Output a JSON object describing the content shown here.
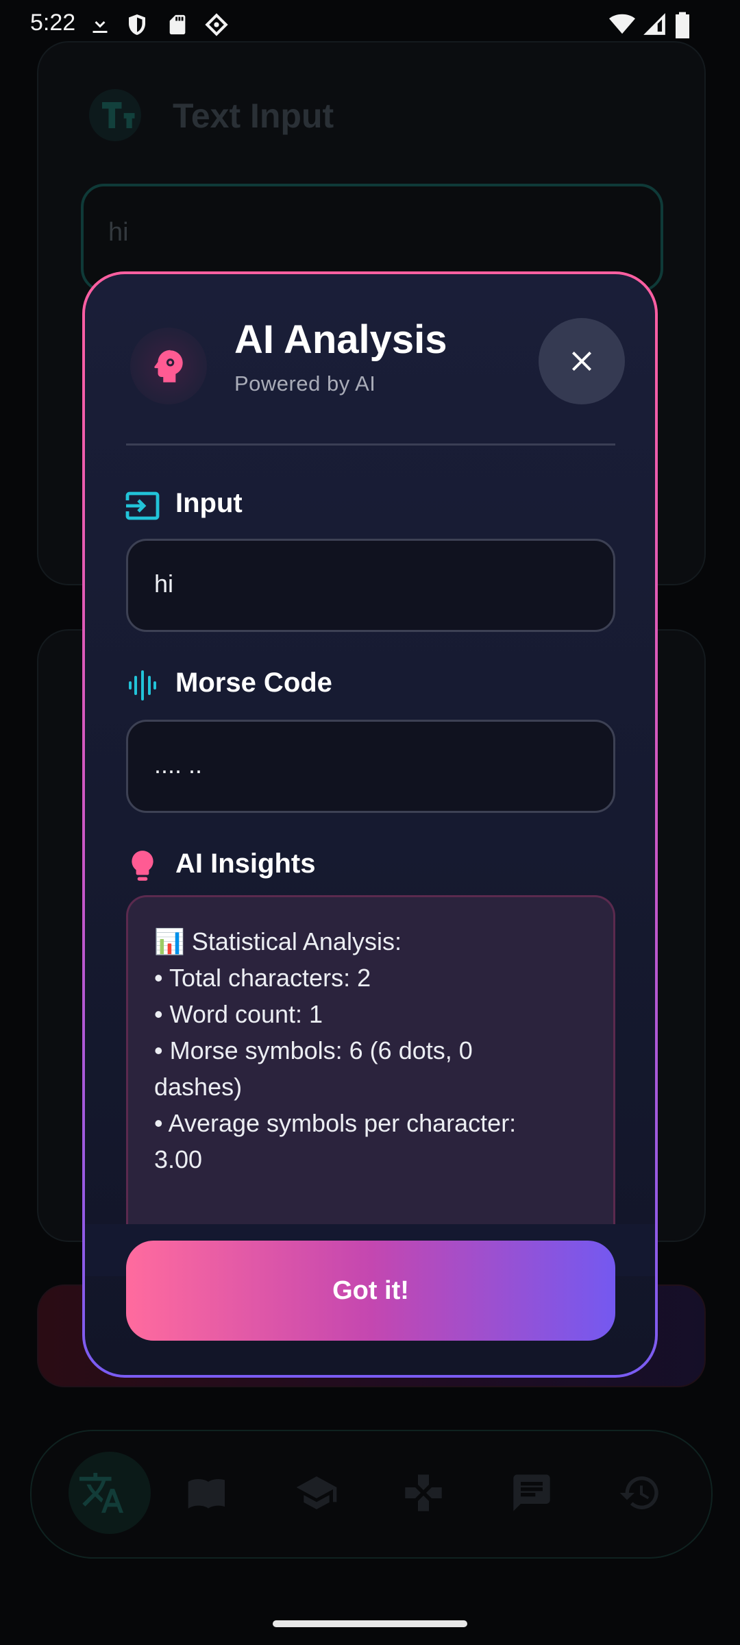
{
  "status_bar": {
    "time": "5:22",
    "left_icons": [
      "download-icon",
      "shield-icon",
      "sd-card-icon",
      "vpn-icon"
    ],
    "right_icons": [
      "wifi-icon",
      "signal-icon",
      "battery-icon"
    ]
  },
  "background": {
    "section_title": "Text Input",
    "input_value": "hi",
    "nav_icons": [
      "translate-icon",
      "book-icon",
      "school-icon",
      "gamepad-icon",
      "chat-icon",
      "history-icon"
    ]
  },
  "dialog": {
    "title": "AI Analysis",
    "subtitle": "Powered by AI",
    "input_label": "Input",
    "input_value": "hi",
    "morse_label": "Morse Code",
    "morse_value": ".... ..",
    "insights_label": "AI Insights",
    "insights_lines": [
      "📊 Statistical Analysis:",
      "• Total characters: 2",
      "• Word count: 1",
      "• Morse symbols: 6 (6 dots, 0",
      "dashes)",
      "• Average symbols per character:",
      "3.00"
    ],
    "confirm_label": "Got it!"
  },
  "colors": {
    "accent_pink": "#ff5fa0",
    "accent_purple": "#7459f0",
    "accent_cyan": "#22c3d8"
  }
}
